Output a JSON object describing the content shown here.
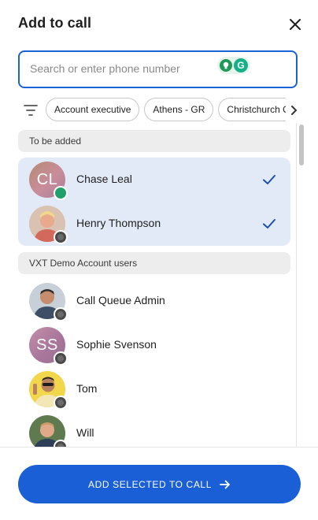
{
  "dialog": {
    "title": "Add to call",
    "close_icon": "close-icon"
  },
  "search": {
    "placeholder": "Search or enter phone number",
    "value": "",
    "extension_icons": [
      "bulb-icon",
      "grammarly-icon"
    ],
    "extension_letter": "G"
  },
  "filters": {
    "icon": "filter-icon",
    "chips": [
      "Account executive",
      "Athens - GR",
      "Christchurch Off"
    ],
    "next_icon": "chevron-right-icon"
  },
  "sections": [
    {
      "header": "To be added",
      "contacts": [
        {
          "name": "Chase Leal",
          "initials": "CL",
          "status": "online",
          "selected": true
        },
        {
          "name": "Henry Thompson",
          "status": "offline",
          "selected": true
        }
      ]
    },
    {
      "header": "VXT Demo Account users",
      "contacts": [
        {
          "name": "Call Queue Admin",
          "status": "offline",
          "selected": false
        },
        {
          "name": "Sophie Svenson",
          "initials": "SS",
          "status": "offline",
          "selected": false
        },
        {
          "name": "Tom",
          "status": "offline",
          "selected": false
        },
        {
          "name": "Will",
          "status": "offline",
          "selected": false
        }
      ]
    }
  ],
  "footer": {
    "button_label": "ADD SELECTED TO CALL",
    "button_icon": "arrow-right-icon"
  },
  "colors": {
    "accent": "#1a5fd6",
    "selected_row": "#e3eaf7",
    "online": "#22a06b",
    "section_header_bg": "#ededed"
  }
}
